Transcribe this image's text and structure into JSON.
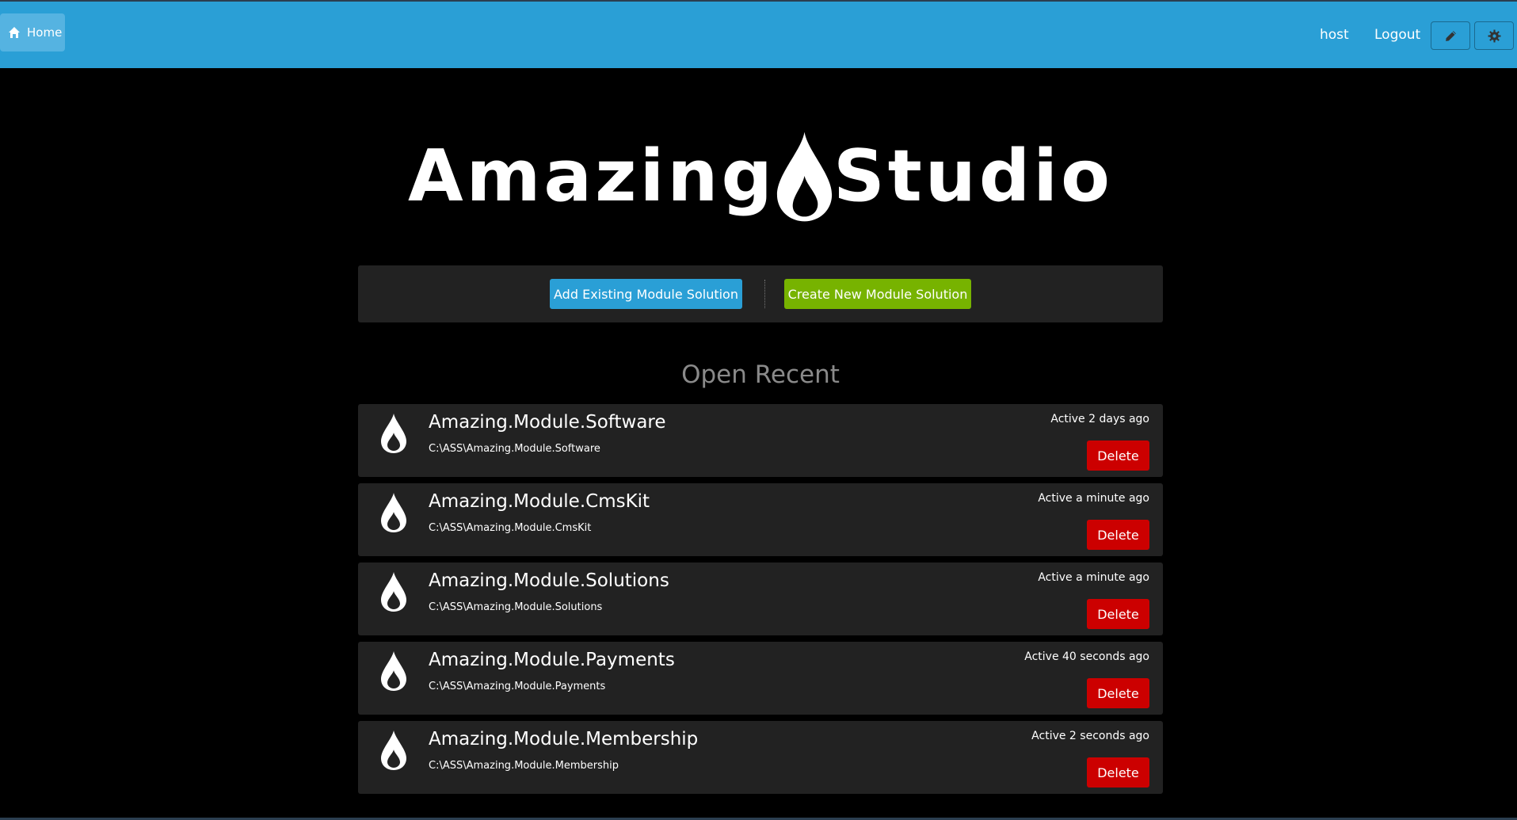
{
  "header": {
    "home_label": "Home",
    "user_label": "host",
    "logout_label": "Logout",
    "edit_icon": "pencil-icon",
    "settings_icon": "gear-icon"
  },
  "logo": {
    "text_left": "Amazing",
    "text_right": "Studio"
  },
  "actions": {
    "add_existing_label": "Add Existing Module Solution",
    "create_new_label": "Create New Module Solution"
  },
  "recent": {
    "title": "Open Recent",
    "delete_label": "Delete",
    "items": [
      {
        "name": "Amazing.Module.Software",
        "path": "C:\\ASS\\Amazing.Module.Software",
        "activity": "Active 2 days ago"
      },
      {
        "name": "Amazing.Module.CmsKit",
        "path": "C:\\ASS\\Amazing.Module.CmsKit",
        "activity": "Active a minute ago"
      },
      {
        "name": "Amazing.Module.Solutions",
        "path": "C:\\ASS\\Amazing.Module.Solutions",
        "activity": "Active a minute ago"
      },
      {
        "name": "Amazing.Module.Payments",
        "path": "C:\\ASS\\Amazing.Module.Payments",
        "activity": "Active 40 seconds ago"
      },
      {
        "name": "Amazing.Module.Membership",
        "path": "C:\\ASS\\Amazing.Module.Membership",
        "activity": "Active 2 seconds ago"
      }
    ]
  },
  "colors": {
    "navbar": "#2a9fd6",
    "primary_button": "#2a9fd6",
    "success_button": "#77b300",
    "danger_button": "#cc0000",
    "panel": "#222222",
    "background": "#000000"
  }
}
